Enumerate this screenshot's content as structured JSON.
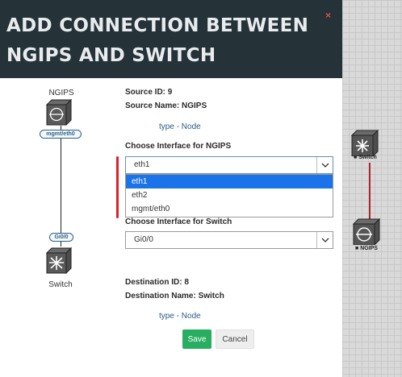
{
  "modal": {
    "title": "ADD CONNECTION BETWEEN NGIPS AND SWITCH",
    "close_symbol": "×"
  },
  "diagram": {
    "source_label": "NGIPS",
    "source_icon": "firewall-icon",
    "source_interface": "mgmt/eth0",
    "dest_interface": "Gi0/0",
    "dest_icon": "switch-icon",
    "dest_label": "Switch"
  },
  "form": {
    "source_id": "Source ID: 9",
    "source_name": "Source Name: NGIPS",
    "source_type": "type - Node",
    "choose_source_label": "Choose Interface for NGIPS",
    "source_select_value": "eth1",
    "source_options": [
      "eth1",
      "eth2",
      "mgmt/eth0"
    ],
    "choose_dest_label": "Choose Interface for Switch",
    "dest_select_value": "Gi0/0",
    "dest_id": "Destination ID: 8",
    "dest_name": "Destination Name: Switch",
    "dest_type": "type - Node",
    "save_label": "Save",
    "cancel_label": "Cancel"
  },
  "canvas": {
    "switch_label": "Switch",
    "ngips_label": "NGIPS"
  },
  "colors": {
    "header_bg": "#253238",
    "link": "#b0262e",
    "save": "#27ae60",
    "highlight": "#1a73e8",
    "annotation": "#e0202a"
  }
}
